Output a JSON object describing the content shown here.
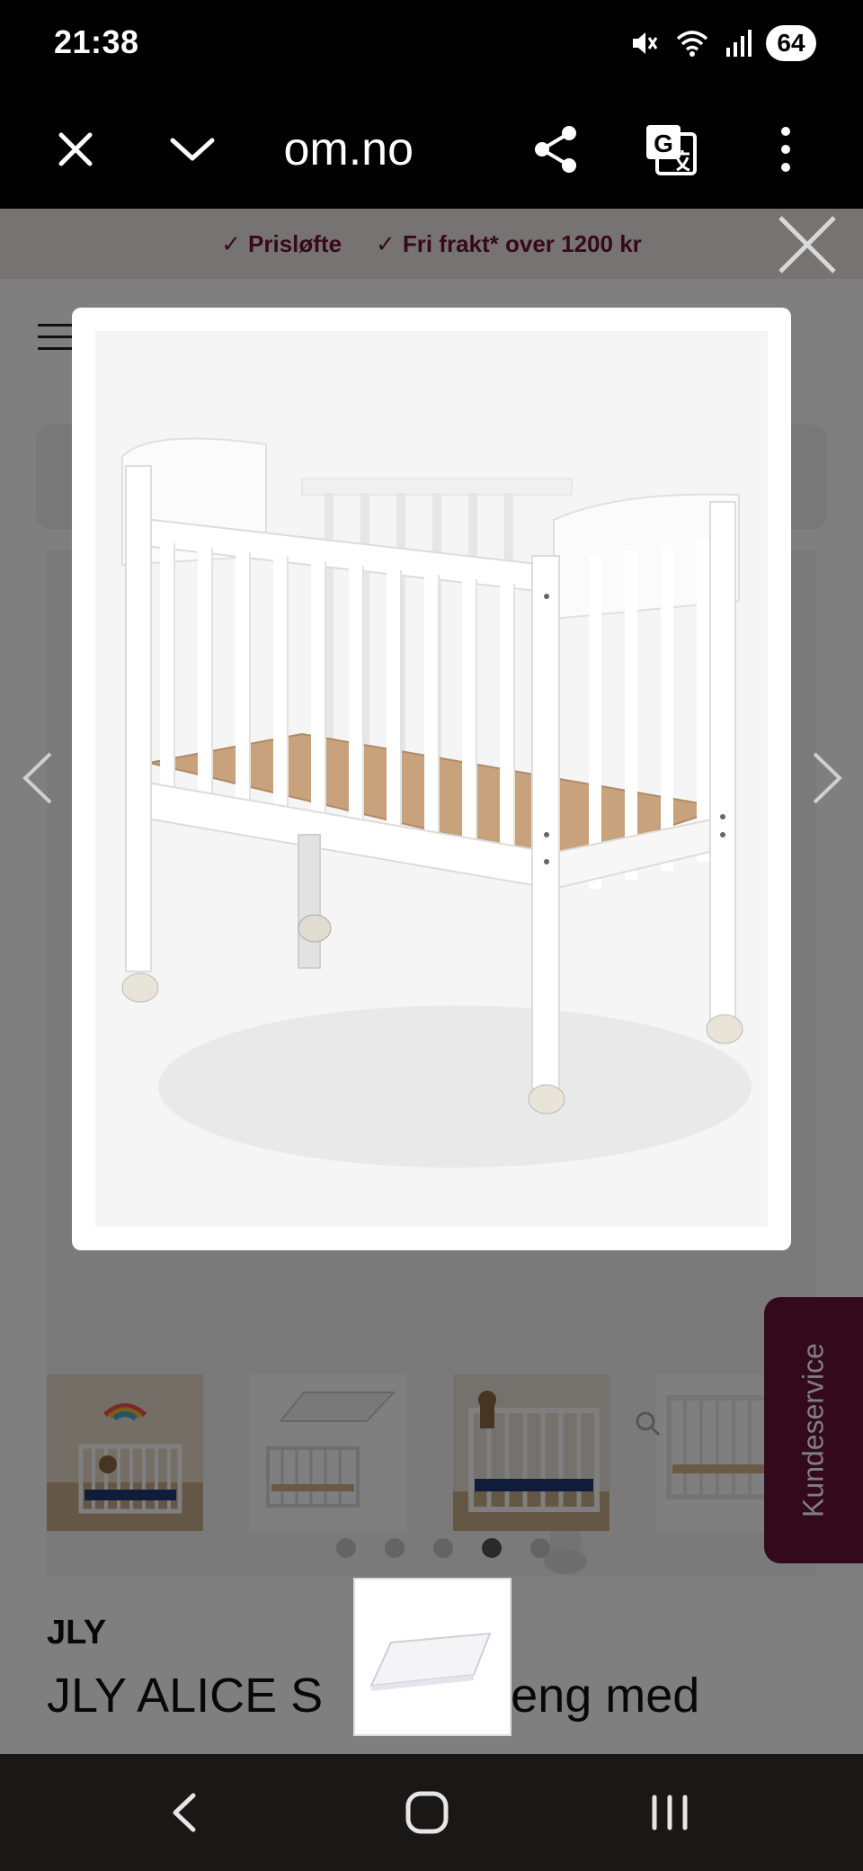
{
  "status_bar": {
    "time": "21:38",
    "battery": "64",
    "icons": [
      "mute-icon",
      "wifi-icon",
      "signal-icon"
    ]
  },
  "browser": {
    "url_partial": "om.no",
    "icons": [
      "close-icon",
      "chevron-down-icon",
      "share-icon",
      "translate-icon",
      "more-vert-icon"
    ]
  },
  "promo": {
    "items": [
      "Prisløfte",
      "Fri frakt* over 1200 kr"
    ]
  },
  "product": {
    "brand": "JLY",
    "title_visible": "JLY ALICE S",
    "title_visible_after": "lseng med"
  },
  "gallery": {
    "dots_count": 5,
    "active_dot_index": 3,
    "thumbnails": [
      "crib-nursery-photo",
      "mattress-and-crib-photo",
      "crib-with-teddy-photo",
      "white-crib-photo"
    ]
  },
  "side_tab": {
    "label": "Kundeservice"
  },
  "colors": {
    "brand": "#6b1239",
    "promo_bg": "#efe7e4",
    "status_bar": "#000000",
    "nav_bar": "#1a1717"
  }
}
